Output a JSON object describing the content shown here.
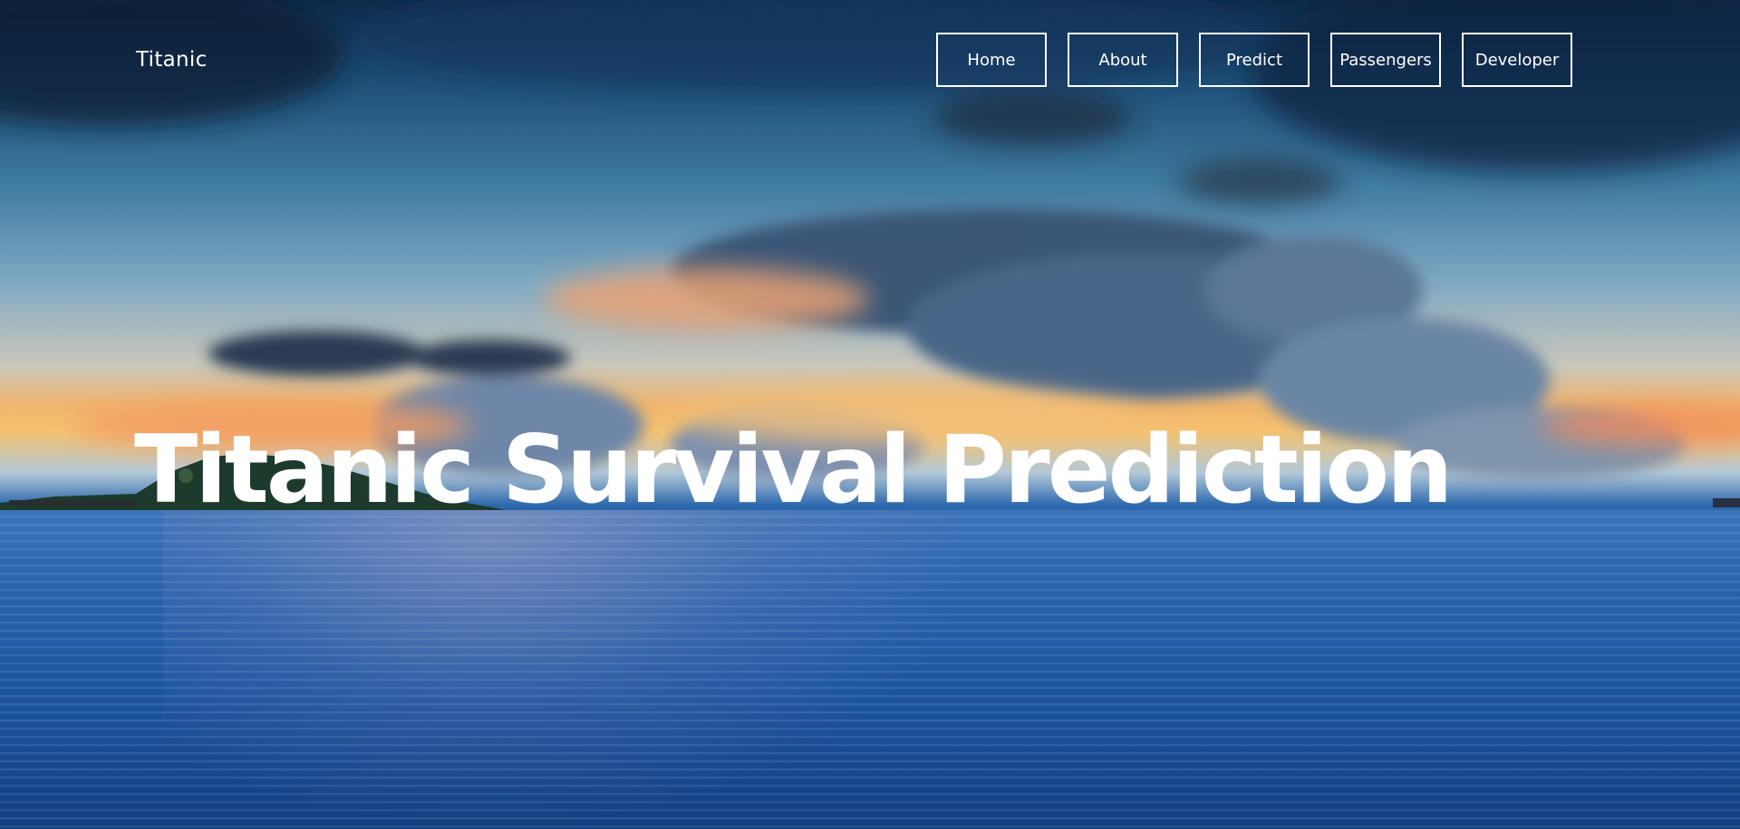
{
  "header": {
    "brand": "Titanic"
  },
  "nav": {
    "items": [
      {
        "label": "Home"
      },
      {
        "label": "About"
      },
      {
        "label": "Predict"
      },
      {
        "label": "Passengers"
      },
      {
        "label": "Developer"
      }
    ]
  },
  "hero": {
    "title": "Titanic Survival Prediction"
  },
  "colors": {
    "nav_border": "#ffffff",
    "text": "#ffffff",
    "sky_top": "#0e2a4a",
    "sunset": "#f5c26f",
    "ocean": "#1d55a1"
  }
}
